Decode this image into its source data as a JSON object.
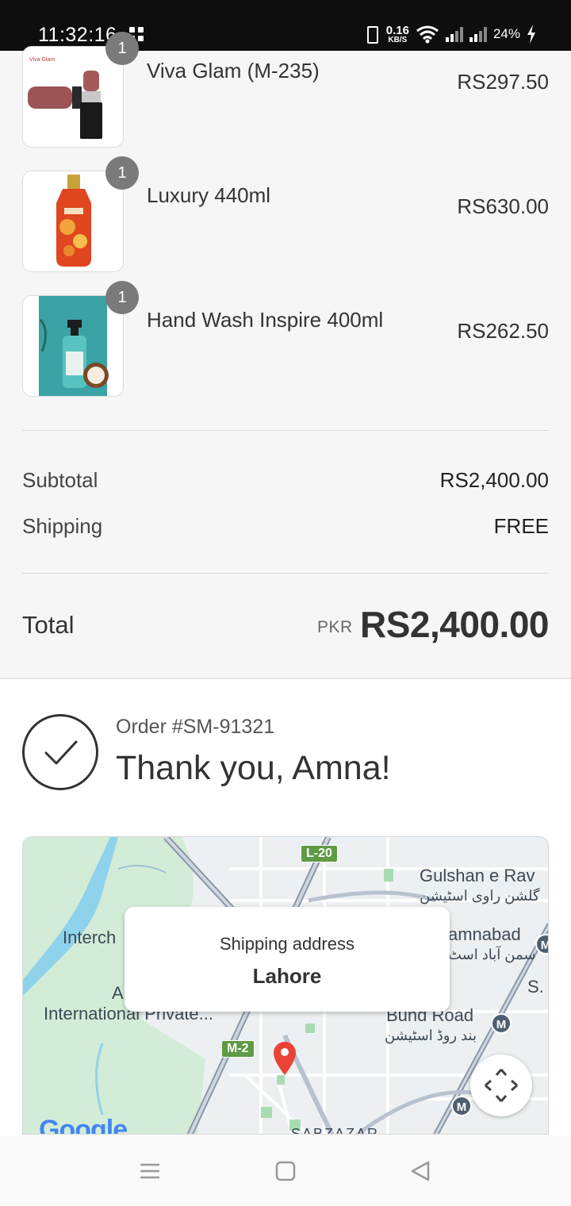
{
  "status_bar": {
    "time": "11:32:16",
    "speed_value": "0.16",
    "speed_unit": "KB/S",
    "battery": "24%"
  },
  "items": [
    {
      "name": "Viva Glam (M-235)",
      "price": "RS297.50",
      "quantity": "1",
      "image": "lipstick-image",
      "image_text": "Viva Glam"
    },
    {
      "name": "Luxury 440ml",
      "price": "RS630.00",
      "quantity": "1",
      "image": "body-wash-bottle-image"
    },
    {
      "name": "Hand Wash Inspire 400ml",
      "price": "RS262.50",
      "quantity": "1",
      "image": "hand-wash-image"
    }
  ],
  "summary": {
    "subtotal_label": "Subtotal",
    "subtotal_value": "RS2,400.00",
    "shipping_label": "Shipping",
    "shipping_value": "FREE",
    "total_label": "Total",
    "currency": "PKR",
    "total_value": "RS2,400.00"
  },
  "confirmation": {
    "order_number": "Order #SM-91321",
    "thank_you": "Thank you, Amna!"
  },
  "map": {
    "popup_title": "Shipping address",
    "popup_city": "Lahore",
    "labels": {
      "gulshan": "Gulshan e Rav",
      "gulshan_urdu": "گلشن راوی اسٹیشن",
      "samnabad": "amnabad",
      "samnabad_urdu": "سمن آباد اسٹ",
      "interch": "Interch",
      "international": "International Private...",
      "a": "A",
      "bund_road": "Bund Road",
      "bund_road_urdu": "بند روڈ اسٹیشن",
      "s_label": "S.",
      "sabzazar": "SABZAZAR",
      "l20": "L-20",
      "m2": "M-2",
      "metro": "M",
      "google": "Google"
    }
  }
}
